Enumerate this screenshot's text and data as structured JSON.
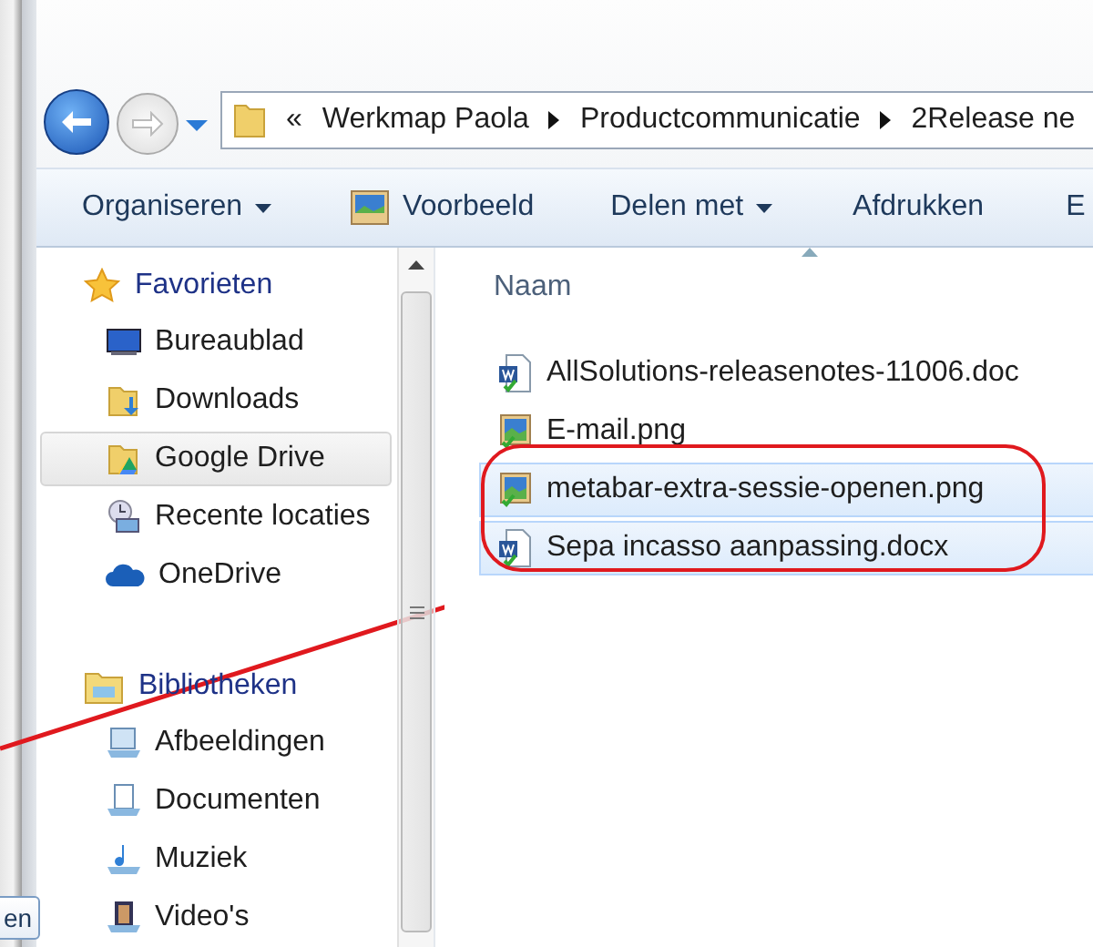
{
  "background_window": {
    "button_label": "en"
  },
  "address_bar": {
    "overflow": "«",
    "crumbs": [
      "Werkmap Paola",
      "Productcommunicatie",
      "2Release ne"
    ]
  },
  "toolbar": [
    {
      "label": "Organiseren",
      "kind": "menu"
    },
    {
      "label": "Voorbeeld",
      "kind": "image"
    },
    {
      "label": "Delen met",
      "kind": "menu"
    },
    {
      "label": "Afdrukken",
      "kind": "plain"
    },
    {
      "label": "E",
      "kind": "plain"
    }
  ],
  "nav": [
    {
      "label": "Favorieten",
      "kind": "star",
      "items": [
        {
          "label": "Bureaublad",
          "kind": "desktop",
          "selected": false
        },
        {
          "label": "Downloads",
          "kind": "downloads",
          "selected": false
        },
        {
          "label": "Google Drive",
          "kind": "drive",
          "selected": true
        },
        {
          "label": "Recente locaties",
          "kind": "recent",
          "selected": false
        },
        {
          "label": "OneDrive",
          "kind": "cloud",
          "selected": false
        }
      ]
    },
    {
      "label": "Bibliotheken",
      "kind": "library",
      "items": [
        {
          "label": "Afbeeldingen",
          "kind": "pictures",
          "selected": false
        },
        {
          "label": "Documenten",
          "kind": "documents",
          "selected": false
        },
        {
          "label": "Muziek",
          "kind": "music",
          "selected": false
        },
        {
          "label": "Video's",
          "kind": "video",
          "selected": false
        }
      ]
    }
  ],
  "files": {
    "column": "Naam",
    "rows": [
      {
        "name": "AllSolutions-releasenotes-11006.doc",
        "kind": "word",
        "selected": false
      },
      {
        "name": "E-mail.png",
        "kind": "image",
        "selected": false
      },
      {
        "name": "metabar-extra-sessie-openen.png",
        "kind": "image",
        "selected": true
      },
      {
        "name": "Sepa incasso aanpassing.docx",
        "kind": "word",
        "selected": true
      }
    ]
  }
}
